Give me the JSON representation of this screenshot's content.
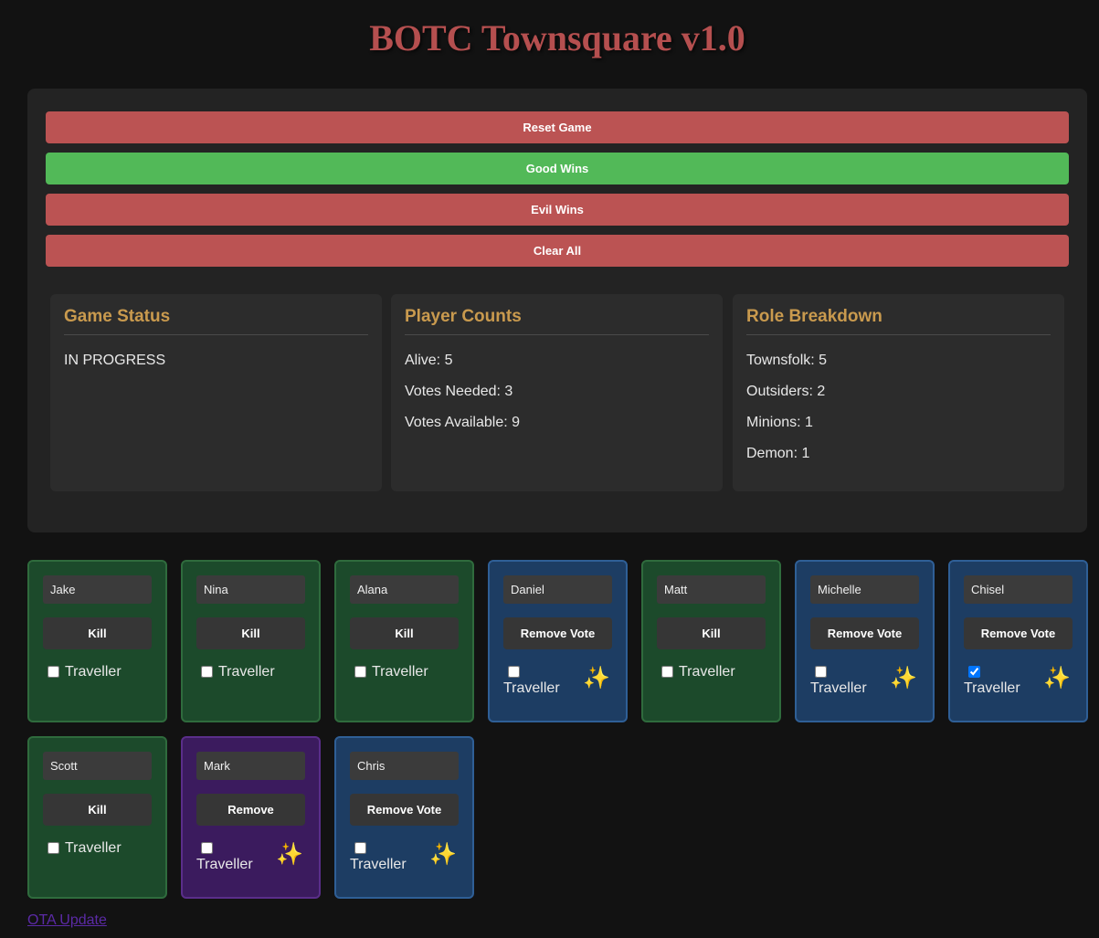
{
  "app": {
    "title": "BOTC Townsquare v1.0"
  },
  "controls": {
    "reset_label": "Reset Game",
    "good_label": "Good Wins",
    "evil_label": "Evil Wins",
    "clear_label": "Clear All"
  },
  "status": {
    "game_status": {
      "heading": "Game Status",
      "value": "IN PROGRESS"
    },
    "player_counts": {
      "heading": "Player Counts",
      "lines": [
        "Alive: 5",
        "Votes Needed: 3",
        "Votes Available: 9"
      ]
    },
    "role_breakdown": {
      "heading": "Role Breakdown",
      "lines": [
        "Townsfolk: 5",
        "Outsiders: 2",
        "Minions: 1",
        "Demon: 1"
      ]
    }
  },
  "players": [
    {
      "name": "Jake",
      "action": "Kill",
      "state": "alive",
      "traveller": false,
      "traveller_label": "Traveller"
    },
    {
      "name": "Nina",
      "action": "Kill",
      "state": "alive",
      "traveller": false,
      "traveller_label": "Traveller"
    },
    {
      "name": "Alana",
      "action": "Kill",
      "state": "alive",
      "traveller": false,
      "traveller_label": "Traveller"
    },
    {
      "name": "Daniel",
      "action": "Remove Vote",
      "state": "dead",
      "traveller": false,
      "traveller_label": "Traveller",
      "icon": "✨"
    },
    {
      "name": "Matt",
      "action": "Kill",
      "state": "alive",
      "traveller": false,
      "traveller_label": "Traveller"
    },
    {
      "name": "Michelle",
      "action": "Remove Vote",
      "state": "dead",
      "traveller": false,
      "traveller_label": "Traveller",
      "icon": "✨"
    },
    {
      "name": "Chisel",
      "action": "Remove Vote",
      "state": "dead",
      "traveller": true,
      "traveller_label": "Traveller",
      "icon": "✨"
    },
    {
      "name": "Scott",
      "action": "Kill",
      "state": "alive",
      "traveller": false,
      "traveller_label": "Traveller"
    },
    {
      "name": "Mark",
      "action": "Remove",
      "state": "dead-novote",
      "traveller": false,
      "traveller_label": "Traveller",
      "icon": "✨"
    },
    {
      "name": "Chris",
      "action": "Remove Vote",
      "state": "dead",
      "traveller": false,
      "traveller_label": "Traveller",
      "icon": "✨"
    }
  ],
  "colors": {
    "alive": "#1c4a2b",
    "dead": "#1d3d63",
    "dead_novote": "#3b1b5e",
    "accent_red": "#bb5353",
    "accent_green": "#52b958"
  },
  "icons": {
    "dead_marker": "sparkles-icon"
  },
  "footer": {
    "ota_label": "OTA Update"
  }
}
